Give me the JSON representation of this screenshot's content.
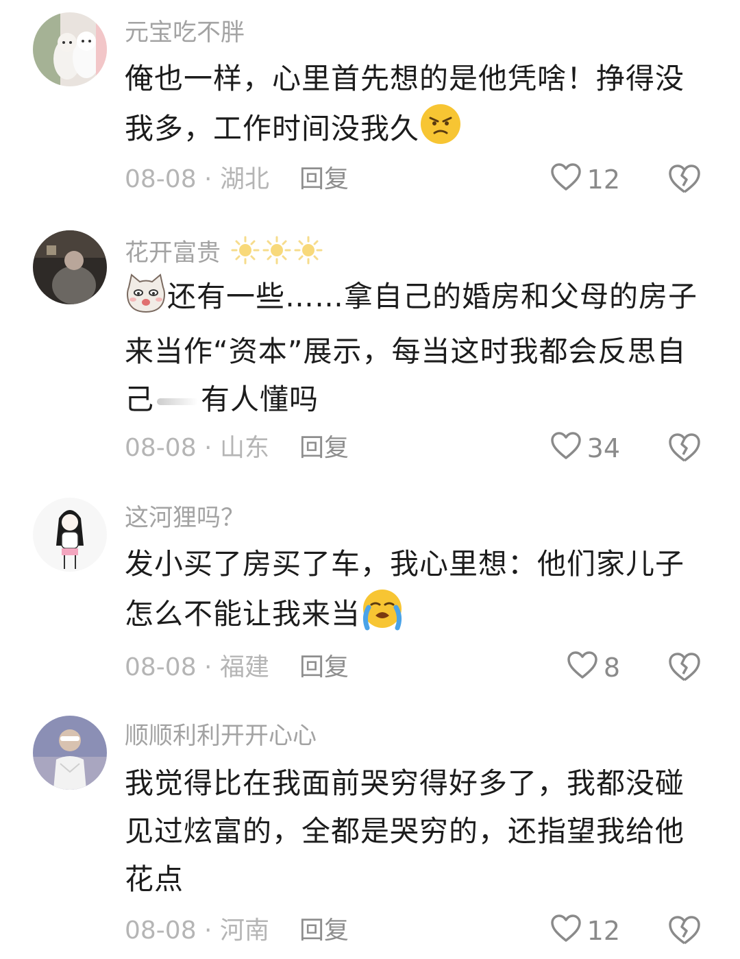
{
  "comments": [
    {
      "username": "元宝吃不胖",
      "text_1": "俺也一样，心里首先想的是他凭啥！挣得没我多，工作时间没我久",
      "emoji": "angry-face-emoji",
      "date_location": "08-08 · 湖北",
      "reply_label": "回复",
      "likes": "12"
    },
    {
      "username": "花开富贵",
      "username_decor": "sun-emoji",
      "text_1": "还有一些……拿自己的婚房和父母的房子来当作“资本”展示，每当这时我都会反思自己",
      "text_2": "有人懂吗",
      "emoji": "cat-face-emoji",
      "date_location": "08-08 · 山东",
      "reply_label": "回复",
      "likes": "34"
    },
    {
      "username": "这河狸吗？",
      "text_1": "发小买了房买了车，我心里想：他们家儿子怎么不能让我来当",
      "emoji": "crying-face-emoji",
      "date_location": "08-08 · 福建",
      "reply_label": "回复",
      "likes": "8"
    },
    {
      "username": "顺顺利利开开心心",
      "text_1": "我觉得比在我面前哭穷得好多了，我都没碰见过炫富的，全都是哭穷的，还指望我给他花点",
      "date_location": "08-08 · 河南",
      "reply_label": "回复",
      "likes": "12"
    }
  ],
  "colors": {
    "username": "#a3a3a3",
    "meta": "#b5b5b5",
    "icon": "#8a8a8a"
  }
}
